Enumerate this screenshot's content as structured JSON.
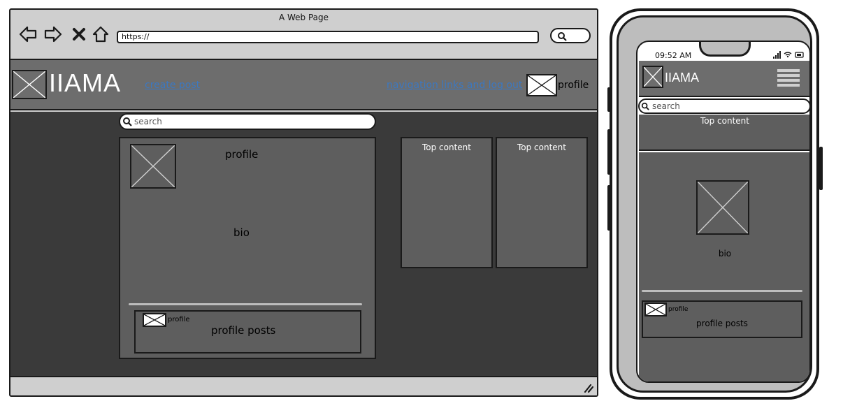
{
  "browser": {
    "window_title": "A Web Page",
    "url": "https://",
    "nav_icons": [
      "back-arrow-icon",
      "forward-arrow-icon",
      "close-icon",
      "home-icon"
    ]
  },
  "header": {
    "logo_text": "IIAMA",
    "create_post": "create post",
    "nav_links": "navigation links and log out",
    "profile": "profile"
  },
  "search": {
    "placeholder": "search"
  },
  "profile_card": {
    "title": "profile",
    "bio": "bio",
    "post_user": "profile",
    "posts_label": "profile posts"
  },
  "top_content": [
    "Top content",
    "Top content"
  ],
  "phone": {
    "time": "09:52 AM",
    "logo_text": "IIAMA",
    "search_placeholder": "search",
    "top_content": "Top content",
    "bio": "bio",
    "post_user": "profile",
    "posts_label": "profile posts"
  },
  "colors": {
    "appbar": "#6d6d6d",
    "content_bg": "#3a3a3a",
    "card_bg": "#5e5e5e",
    "link": "#3b78c2",
    "chrome": "#cfcfcf"
  }
}
